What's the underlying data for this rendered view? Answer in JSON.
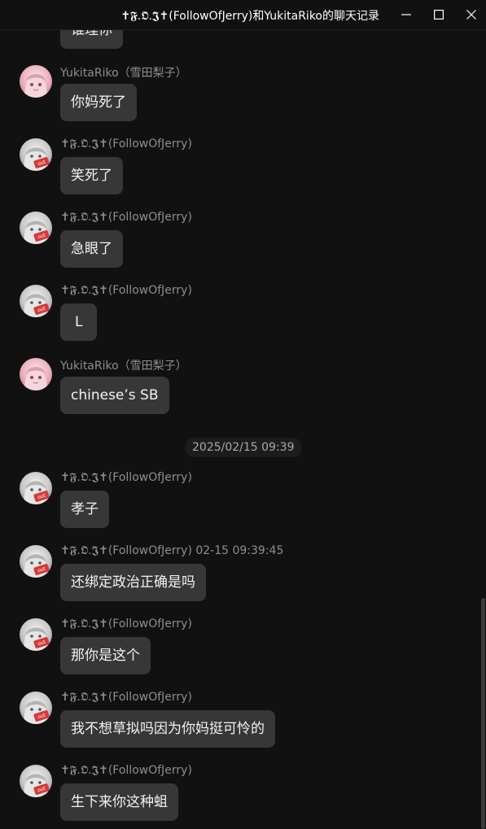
{
  "window": {
    "title": "✝𝕱.𝕺.𝕵✝(FollowOfJerry)和YukitaRiko的聊天记录",
    "minimize_icon": "minimize-icon",
    "maximize_icon": "maximize-icon",
    "close_icon": "close-icon"
  },
  "partial_top_message": {
    "text": "谁理你"
  },
  "messages": [
    {
      "sender": "YukitaRiko（雪田梨子）",
      "text": "你妈死了",
      "avatar": "pink-anime-avatar"
    },
    {
      "sender": "✝𝕱.𝕺.𝕵✝(FollowOfJerry)",
      "text": "笑死了",
      "avatar": "grey-out-avatar"
    },
    {
      "sender": "✝𝕱.𝕺.𝕵✝(FollowOfJerry)",
      "text": "急眼了",
      "avatar": "grey-out-avatar"
    },
    {
      "sender": "✝𝕱.𝕺.𝕵✝(FollowOfJerry)",
      "text": "L",
      "avatar": "grey-out-avatar"
    },
    {
      "sender": "YukitaRiko（雪田梨子）",
      "text": "chinese’s SB",
      "avatar": "pink-anime-avatar"
    },
    {
      "sender": "✝𝕱.𝕺.𝕵✝(FollowOfJerry)",
      "text": "孝子",
      "avatar": "grey-out-avatar"
    },
    {
      "sender": "✝𝕱.𝕺.𝕵✝(FollowOfJerry) 02-15 09:39:45",
      "text": "还绑定政治正确是吗",
      "avatar": "grey-out-avatar"
    },
    {
      "sender": "✝𝕱.𝕺.𝕵✝(FollowOfJerry)",
      "text": "那你是这个",
      "avatar": "grey-out-avatar"
    },
    {
      "sender": "✝𝕱.𝕺.𝕵✝(FollowOfJerry)",
      "text": "我不想草拟吗因为你妈挺可怜的",
      "avatar": "grey-out-avatar"
    },
    {
      "sender": "✝𝕱.𝕺.𝕵✝(FollowOfJerry)",
      "text": "生下来你这种蛆",
      "avatar": "grey-out-avatar"
    }
  ],
  "timestamp_divider": "2025/02/15 09:39",
  "avatar_badge": "out"
}
